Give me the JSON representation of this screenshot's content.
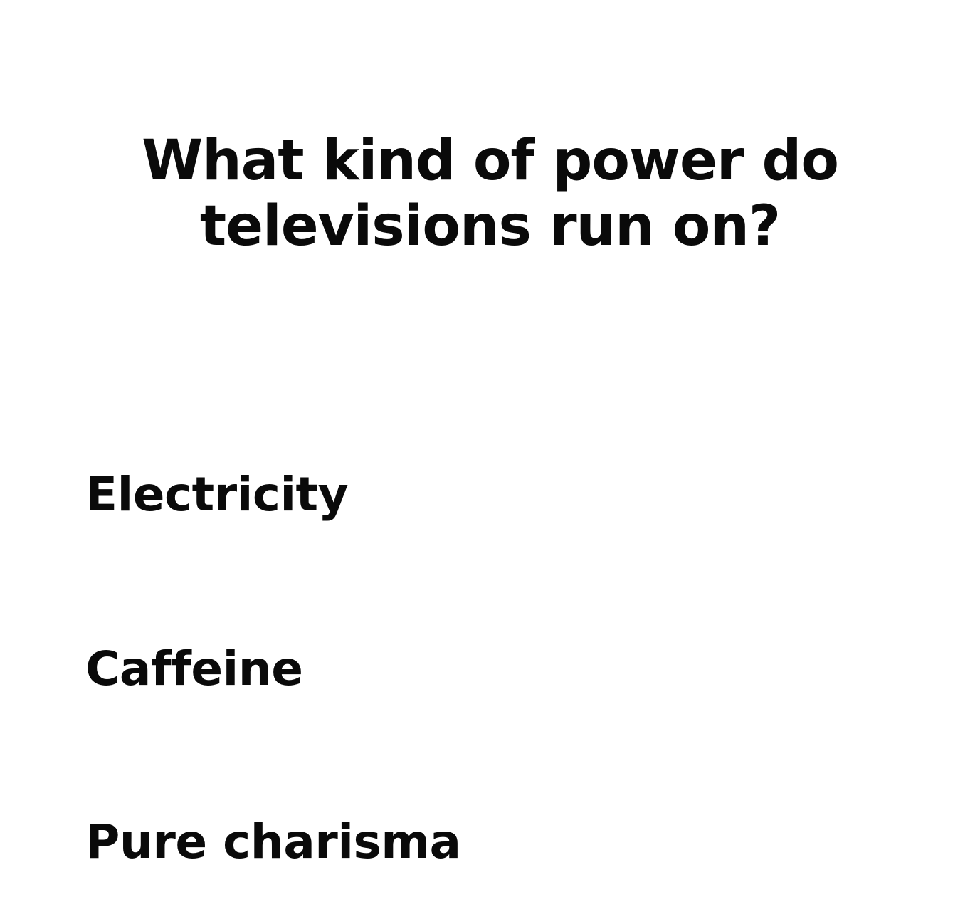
{
  "quiz": {
    "question": "What kind of power do televisions run on?",
    "options": [
      {
        "label": "Electricity"
      },
      {
        "label": "Caffeine"
      },
      {
        "label": "Pure charisma"
      }
    ]
  },
  "colors": {
    "background": "#ffffff",
    "text": "#0a0a0a"
  }
}
